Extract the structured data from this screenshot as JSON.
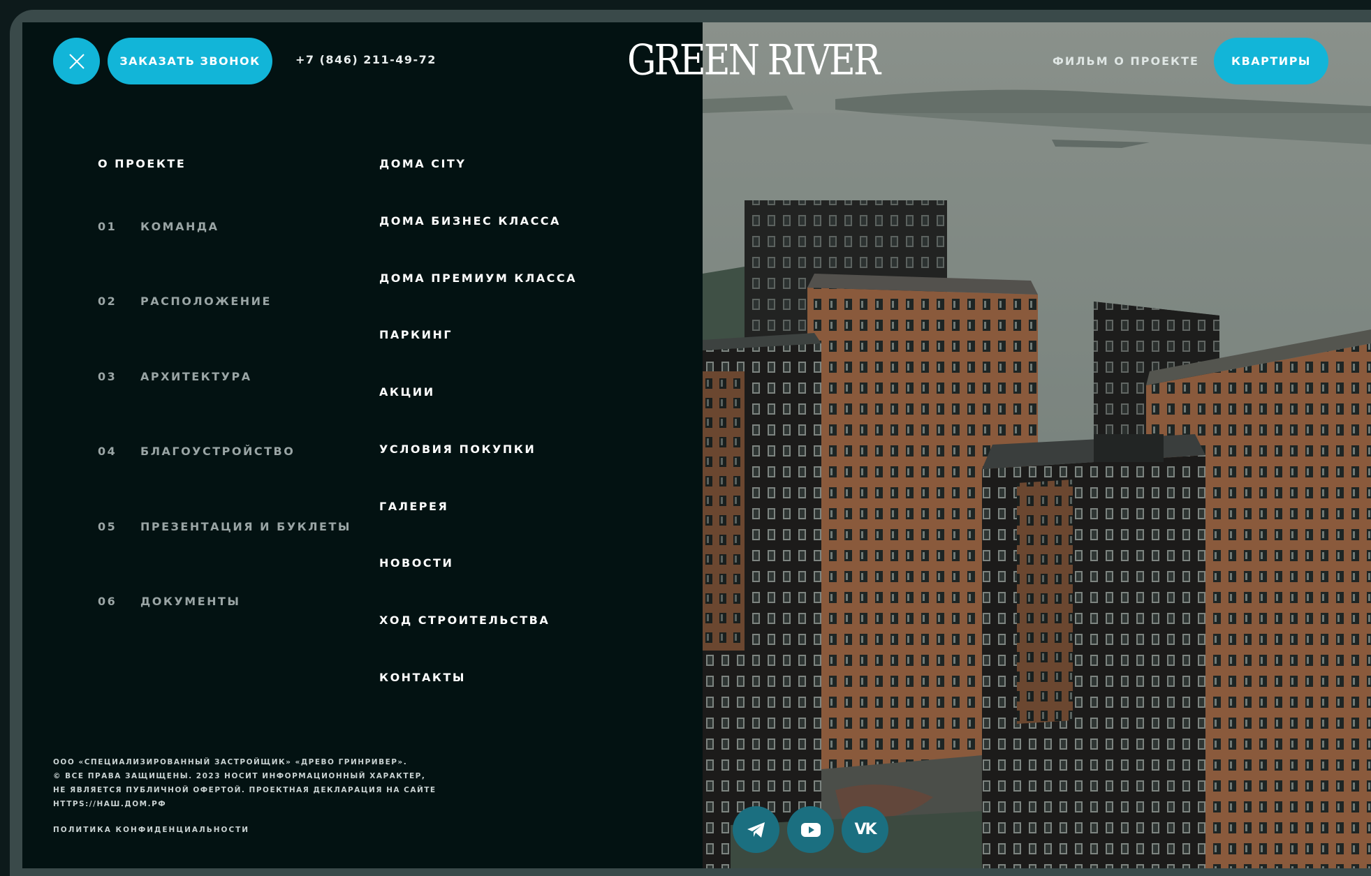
{
  "header": {
    "call_button": "ЗАКАЗАТЬ ЗВОНОК",
    "phone": "+7 (846) 211-49-72",
    "logo": "GREEN RIVER",
    "film_link": "ФИЛЬМ О ПРОЕКТЕ",
    "apartments_button": "КВАРТИРЫ",
    "close_icon": "close-icon"
  },
  "about": {
    "heading": "О ПРОЕКТЕ",
    "items": [
      {
        "num": "01",
        "label": "КОМАНДА"
      },
      {
        "num": "02",
        "label": "РАСПОЛОЖЕНИЕ"
      },
      {
        "num": "03",
        "label": "АРХИТЕКТУРА"
      },
      {
        "num": "04",
        "label": "БЛАГОУСТРОЙСТВО"
      },
      {
        "num": "05",
        "label": "ПРЕЗЕНТАЦИЯ И БУКЛЕТЫ"
      },
      {
        "num": "06",
        "label": "ДОКУМЕНТЫ"
      }
    ]
  },
  "main_menu": [
    "ДОМА CITY",
    "ДОМА БИЗНЕС КЛАССА",
    "ДОМА ПРЕМИУМ КЛАССА",
    "ПАРКИНГ",
    "АКЦИИ",
    "УСЛОВИЯ ПОКУПКИ",
    "ГАЛЕРЕЯ",
    "НОВОСТИ",
    "ХОД СТРОИТЕЛЬСТВА",
    "КОНТАКТЫ"
  ],
  "footer": {
    "legal_lines": [
      "ООО «СПЕЦИАЛИЗИРОВАННЫЙ ЗАСТРОЙЩИК» «ДРЕВО ГРИНРИВЕР».",
      "© ВСЕ ПРАВА ЗАЩИЩЕНЫ. 2023 НОСИТ ИНФОРМАЦИОННЫЙ ХАРАКТЕР,",
      "НЕ ЯВЛЯЕТСЯ ПУБЛИЧНОЙ ОФЕРТОЙ. ПРОЕКТНАЯ ДЕКЛАРАЦИЯ НА САЙТЕ",
      "HTTPS://НАШ.ДОМ.РФ"
    ],
    "privacy": "ПОЛИТИКА КОНФИДЕНЦИАЛЬНОСТИ"
  },
  "social": [
    {
      "icon": "telegram-icon"
    },
    {
      "icon": "youtube-icon"
    },
    {
      "icon": "vk-icon",
      "label": "VK"
    }
  ],
  "colors": {
    "accent": "#12b5d8",
    "panel": "#031212",
    "social": "#1b6f80"
  }
}
